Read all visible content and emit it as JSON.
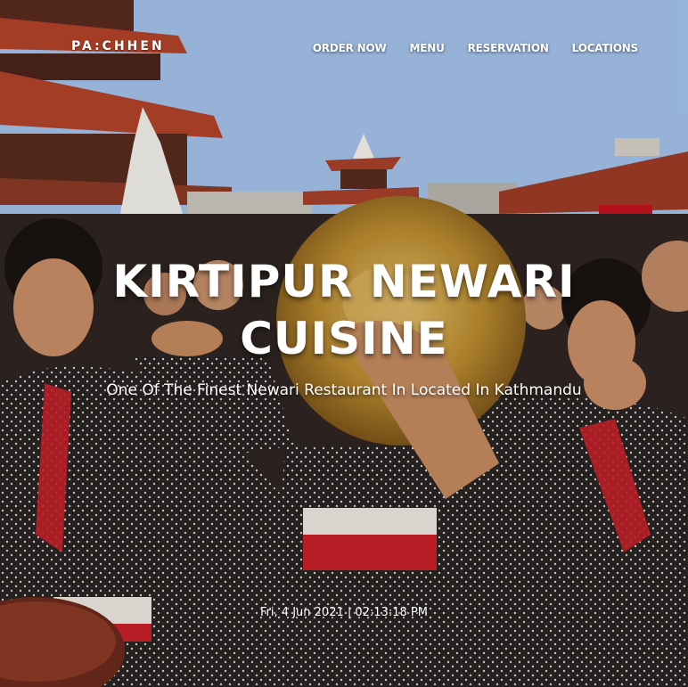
{
  "brand": {
    "name": "PA:CHHEN"
  },
  "nav": {
    "items": [
      {
        "label": "ORDER NOW"
      },
      {
        "label": "MENU"
      },
      {
        "label": "RESERVATION"
      },
      {
        "label": "LOCATIONS"
      }
    ]
  },
  "hero": {
    "title": "KIRTIPUR NEWARI CUISINE",
    "subtitle": "One Of The Finest Newari Restaurant In Located In Kathmandu",
    "datetime": "Fri, 4 Jun 2021 | 02:13:18 PM"
  },
  "colors": {
    "sky": "#9dbde6",
    "temple_roof": "#b1432a",
    "dress_dark": "#2a2424",
    "accent_red": "#c8202a",
    "cymbal_gold": "#b8892e"
  }
}
